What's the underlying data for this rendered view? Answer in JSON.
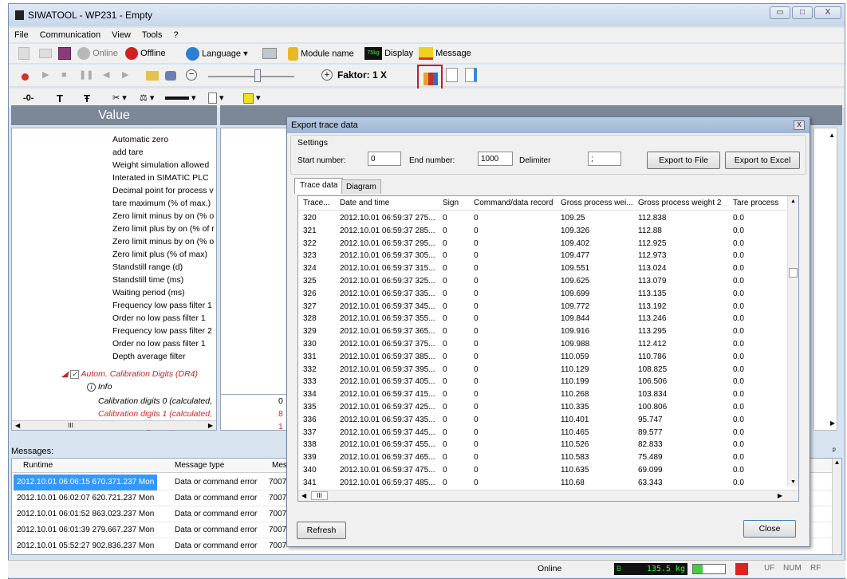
{
  "window": {
    "title": "SIWATOOL - WP231 - Empty",
    "min": "▭",
    "max": "□",
    "close": "X"
  },
  "menu": [
    "File",
    "Communication",
    "View",
    "Tools",
    "?"
  ],
  "toolbar1": {
    "online": "Online",
    "offline": "Offline",
    "language": "Language",
    "module_name": "Module name",
    "display": "Display",
    "display_icon_text": "75kg",
    "message": "Message"
  },
  "toolbar2": {
    "factor": "Faktor: 1 X"
  },
  "toolbar3": {
    "t1": "T",
    "t2": "Ŧ"
  },
  "left_panel": {
    "header": "Value",
    "rows": [
      {
        "label": "Automatic zero",
        "style": "normal"
      },
      {
        "label": "add tare",
        "style": "normal"
      },
      {
        "label": "Weight simulation allowed",
        "style": "normal"
      },
      {
        "label": "Interated in SIMATIC PLC",
        "style": "normal"
      },
      {
        "label": "Decimal point for process v",
        "style": "normal"
      },
      {
        "label": "tare maximum (% of max.)",
        "style": "normal"
      },
      {
        "label": "Zero limit minus by on (% o",
        "style": "normal"
      },
      {
        "label": "Zero limit plus by on (% of r",
        "style": "normal"
      },
      {
        "label": "Zero limit minus by on (% o",
        "style": "normal"
      },
      {
        "label": "Zero limit plus (% of max)",
        "style": "normal"
      },
      {
        "label": "Standstill range (d)",
        "style": "normal"
      },
      {
        "label": "Standstill time (ms)",
        "style": "normal"
      },
      {
        "label": "Waiting period (ms)",
        "style": "normal"
      },
      {
        "label": "Frequency low pass filter 1",
        "style": "normal"
      },
      {
        "label": "Order no low pass filter 1",
        "style": "normal"
      },
      {
        "label": "Frequency low pass filter 2",
        "style": "normal"
      },
      {
        "label": "Order no low pass filter 1",
        "style": "normal"
      },
      {
        "label": "Depth average filter",
        "style": "normal"
      }
    ],
    "group": "Autom. Calibration Digits (DR4)",
    "info": "Info",
    "calib": [
      {
        "label": "Calibration digits 0 (calculated,",
        "value": "0",
        "style": "black"
      },
      {
        "label": "Calibration digits 1 (calculated,",
        "value": "8",
        "style": "red"
      },
      {
        "label": "Calibration digits 2 (calculated",
        "value": "1",
        "style": "red"
      }
    ],
    "hscroll": "III"
  },
  "messages": {
    "title": "Messages:",
    "pin": "ᵖ",
    "columns": [
      "Runtime",
      "Message type",
      "Mes"
    ],
    "rows": [
      {
        "runtime": "2012.10.01 06:06:15 670.371.237 Mon",
        "type": "Data or command error",
        "code": "7007"
      },
      {
        "runtime": "2012.10.01 06:02:07 620.721.237 Mon",
        "type": "Data or command error",
        "code": "7007"
      },
      {
        "runtime": "2012.10.01 06:01:52 863.023.237 Mon",
        "type": "Data or command error",
        "code": "7007"
      },
      {
        "runtime": "2012.10.01 06:01:39 279.667.237 Mon",
        "type": "Data or command error",
        "code": "7007"
      },
      {
        "runtime": "2012.10.01 05:52:27 902.836.237 Mon",
        "type": "Data or command error",
        "code": "7007"
      }
    ]
  },
  "status": {
    "online": "Online",
    "badge": "B",
    "weight": "135.5 kg",
    "uf": "UF",
    "num": "NUM",
    "rf": "RF"
  },
  "dialog": {
    "title": "Export trace data",
    "close": "X",
    "settings": "Settings",
    "start_label": "Start number:",
    "start_value": "0",
    "end_label": "End number:",
    "end_value": "1000",
    "delim_label": "Delimiter",
    "delim_value": ";",
    "export_file": "Export to File",
    "export_excel": "Export to Excel",
    "tabs": [
      "Trace data",
      "Diagram"
    ],
    "refresh": "Refresh",
    "close_btn": "Close",
    "hscroll": "III",
    "columns": [
      "Trace...",
      "Date and time",
      "Sign",
      "Command/data record",
      "Gross process wei...",
      "Gross process weight 2",
      "Tare process"
    ],
    "rows": [
      [
        "320",
        "2012.10.01 06:59:37 275...",
        "0",
        "0",
        "109.25",
        "112.838",
        "0.0"
      ],
      [
        "321",
        "2012.10.01 06:59:37 285...",
        "0",
        "0",
        "109.326",
        "112.88",
        "0.0"
      ],
      [
        "322",
        "2012.10.01 06:59:37 295...",
        "0",
        "0",
        "109.402",
        "112.925",
        "0.0"
      ],
      [
        "323",
        "2012.10.01 06:59:37 305...",
        "0",
        "0",
        "109.477",
        "112.973",
        "0.0"
      ],
      [
        "324",
        "2012.10.01 06:59:37 315...",
        "0",
        "0",
        "109.551",
        "113.024",
        "0.0"
      ],
      [
        "325",
        "2012.10.01 06:59:37 325...",
        "0",
        "0",
        "109.625",
        "113.079",
        "0.0"
      ],
      [
        "326",
        "2012.10.01 06:59:37 335...",
        "0",
        "0",
        "109.699",
        "113.135",
        "0.0"
      ],
      [
        "327",
        "2012.10.01 06:59:37 345...",
        "0",
        "0",
        "109.772",
        "113.192",
        "0.0"
      ],
      [
        "328",
        "2012.10.01 06:59:37 355...",
        "0",
        "0",
        "109.844",
        "113.246",
        "0.0"
      ],
      [
        "329",
        "2012.10.01 06:59:37 365...",
        "0",
        "0",
        "109.916",
        "113.295",
        "0.0"
      ],
      [
        "330",
        "2012.10.01 06:59:37 375...",
        "0",
        "0",
        "109.988",
        "112.412",
        "0.0"
      ],
      [
        "331",
        "2012.10.01 06:59:37 385...",
        "0",
        "0",
        "110.059",
        "110.786",
        "0.0"
      ],
      [
        "332",
        "2012.10.01 06:59:37 395...",
        "0",
        "0",
        "110.129",
        "108.825",
        "0.0"
      ],
      [
        "333",
        "2012.10.01 06:59:37 405...",
        "0",
        "0",
        "110.199",
        "106.506",
        "0.0"
      ],
      [
        "334",
        "2012.10.01 06:59:37 415...",
        "0",
        "0",
        "110.268",
        "103.834",
        "0.0"
      ],
      [
        "335",
        "2012.10.01 06:59:37 425...",
        "0",
        "0",
        "110.335",
        "100.806",
        "0.0"
      ],
      [
        "336",
        "2012.10.01 06:59:37 435...",
        "0",
        "0",
        "110.401",
        "95.747",
        "0.0"
      ],
      [
        "337",
        "2012.10.01 06:59:37 445...",
        "0",
        "0",
        "110.465",
        "89.577",
        "0.0"
      ],
      [
        "338",
        "2012.10.01 06:59:37 455...",
        "0",
        "0",
        "110.526",
        "82.833",
        "0.0"
      ],
      [
        "339",
        "2012.10.01 06:59:37 465...",
        "0",
        "0",
        "110.583",
        "75.489",
        "0.0"
      ],
      [
        "340",
        "2012.10.01 06:59:37 475...",
        "0",
        "0",
        "110.635",
        "69.099",
        "0.0"
      ],
      [
        "341",
        "2012.10.01 06:59:37 485...",
        "0",
        "0",
        "110.68",
        "63.343",
        "0.0"
      ]
    ]
  }
}
